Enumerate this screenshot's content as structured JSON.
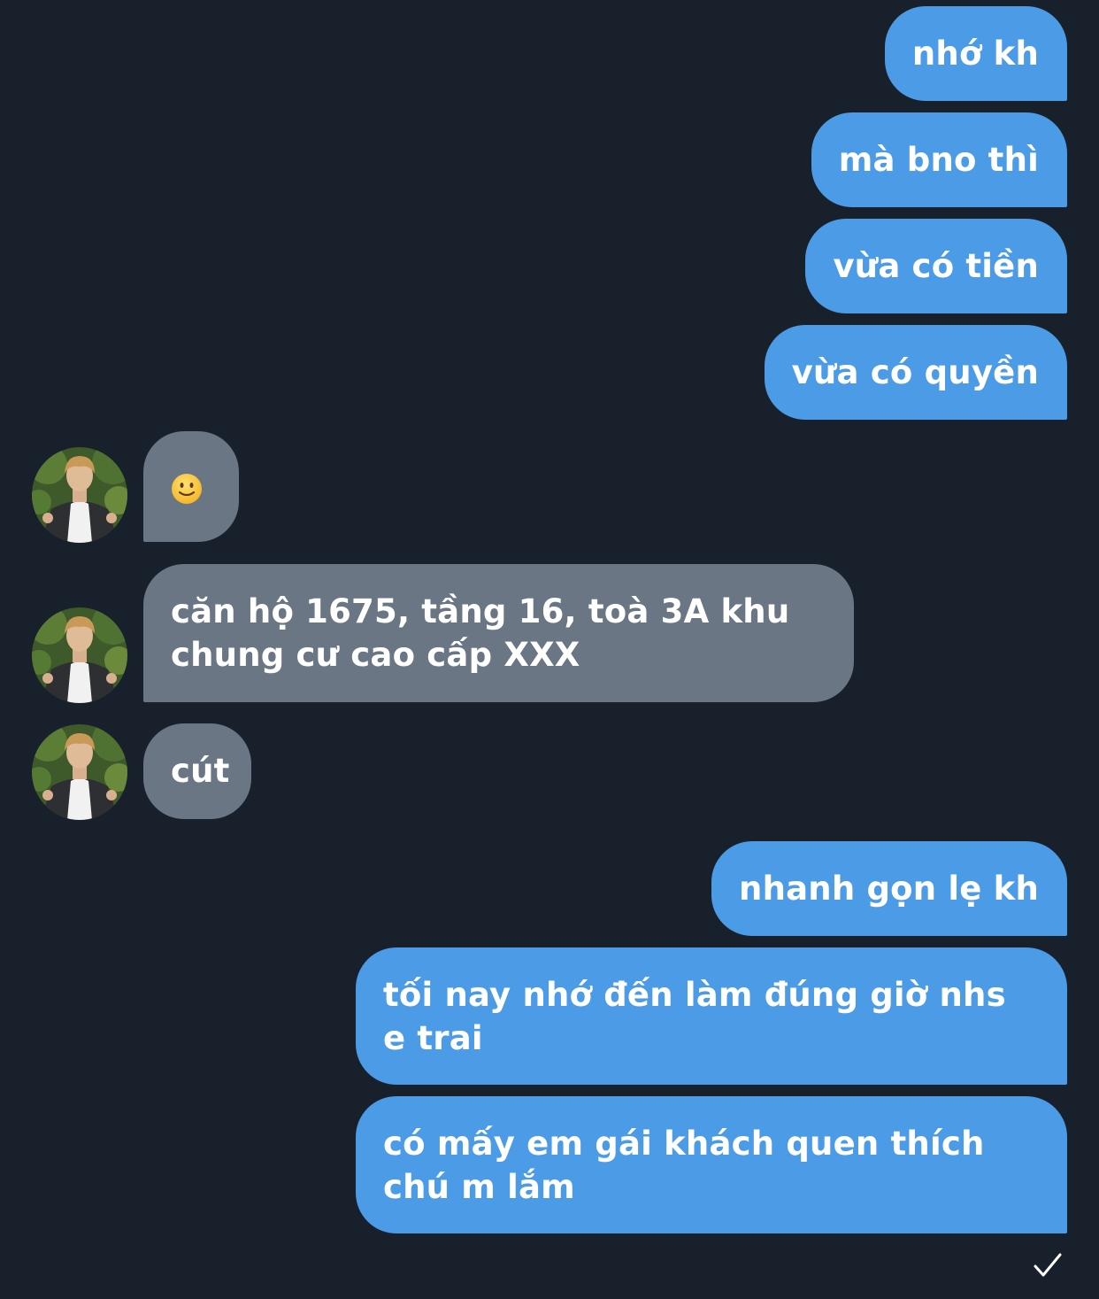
{
  "conversation": {
    "messages": [
      {
        "direction": "outgoing",
        "text": "nhớ kh"
      },
      {
        "direction": "outgoing",
        "text": "mà bno thì"
      },
      {
        "direction": "outgoing",
        "text": "vừa có tiền"
      },
      {
        "direction": "outgoing",
        "text": "vừa có quyền"
      },
      {
        "direction": "incoming",
        "emoji": "slightly-smiling-face-icon",
        "text": "🙂"
      },
      {
        "direction": "incoming",
        "text": "căn hộ 1675, tầng 16, toà 3A khu chung cư cao cấp XXX"
      },
      {
        "direction": "incoming",
        "text": "cút"
      },
      {
        "direction": "outgoing",
        "text": "nhanh gọn lẹ kh"
      },
      {
        "direction": "outgoing",
        "text": "tối nay nhớ đến làm đúng giờ nhs e trai"
      },
      {
        "direction": "outgoing",
        "text": "có mấy em gái khách quen thích chú m lắm"
      }
    ],
    "read_receipt_icon": "checkmark-icon"
  },
  "colors": {
    "background": "#18202b",
    "outgoing_bubble": "#4b9be6",
    "incoming_bubble": "#6a7684",
    "text": "#ffffff"
  }
}
